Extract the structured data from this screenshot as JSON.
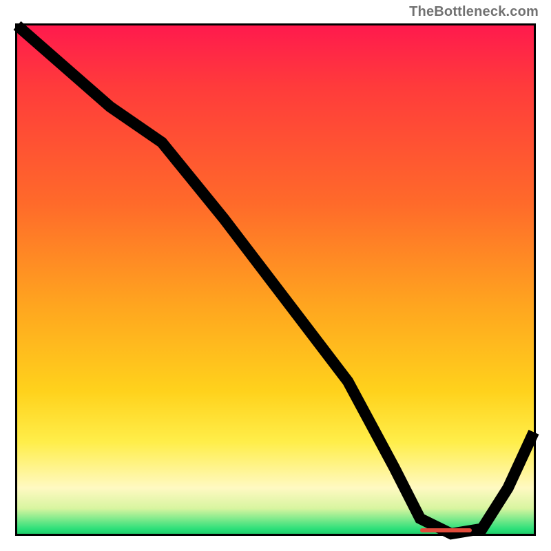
{
  "watermark": "TheBottleneck.com",
  "chart_data": {
    "type": "line",
    "title": "",
    "xlabel": "",
    "ylabel": "",
    "xlim": [
      0,
      100
    ],
    "ylim": [
      0,
      100
    ],
    "series": [
      {
        "name": "curve",
        "x": [
          0,
          9,
          18,
          28,
          40,
          52,
          64,
          73,
          78,
          84,
          90,
          95,
          100
        ],
        "y": [
          100,
          92,
          84,
          77,
          62,
          46,
          30,
          13,
          3,
          0,
          1,
          9,
          20
        ]
      }
    ],
    "gradient_stops": [
      {
        "pos": 0,
        "color": "#ff1a4d"
      },
      {
        "pos": 12,
        "color": "#ff3b3b"
      },
      {
        "pos": 35,
        "color": "#ff6a2a"
      },
      {
        "pos": 55,
        "color": "#ffa51f"
      },
      {
        "pos": 72,
        "color": "#ffd21c"
      },
      {
        "pos": 82,
        "color": "#ffee4a"
      },
      {
        "pos": 91,
        "color": "#fff9c2"
      },
      {
        "pos": 95,
        "color": "#d8f5a0"
      },
      {
        "pos": 99,
        "color": "#2ee07a"
      },
      {
        "pos": 100,
        "color": "#1fcf6b"
      }
    ],
    "bottleneck_band": {
      "x_start": 78,
      "x_end": 88,
      "y": 0,
      "color": "#e24b3b"
    }
  }
}
